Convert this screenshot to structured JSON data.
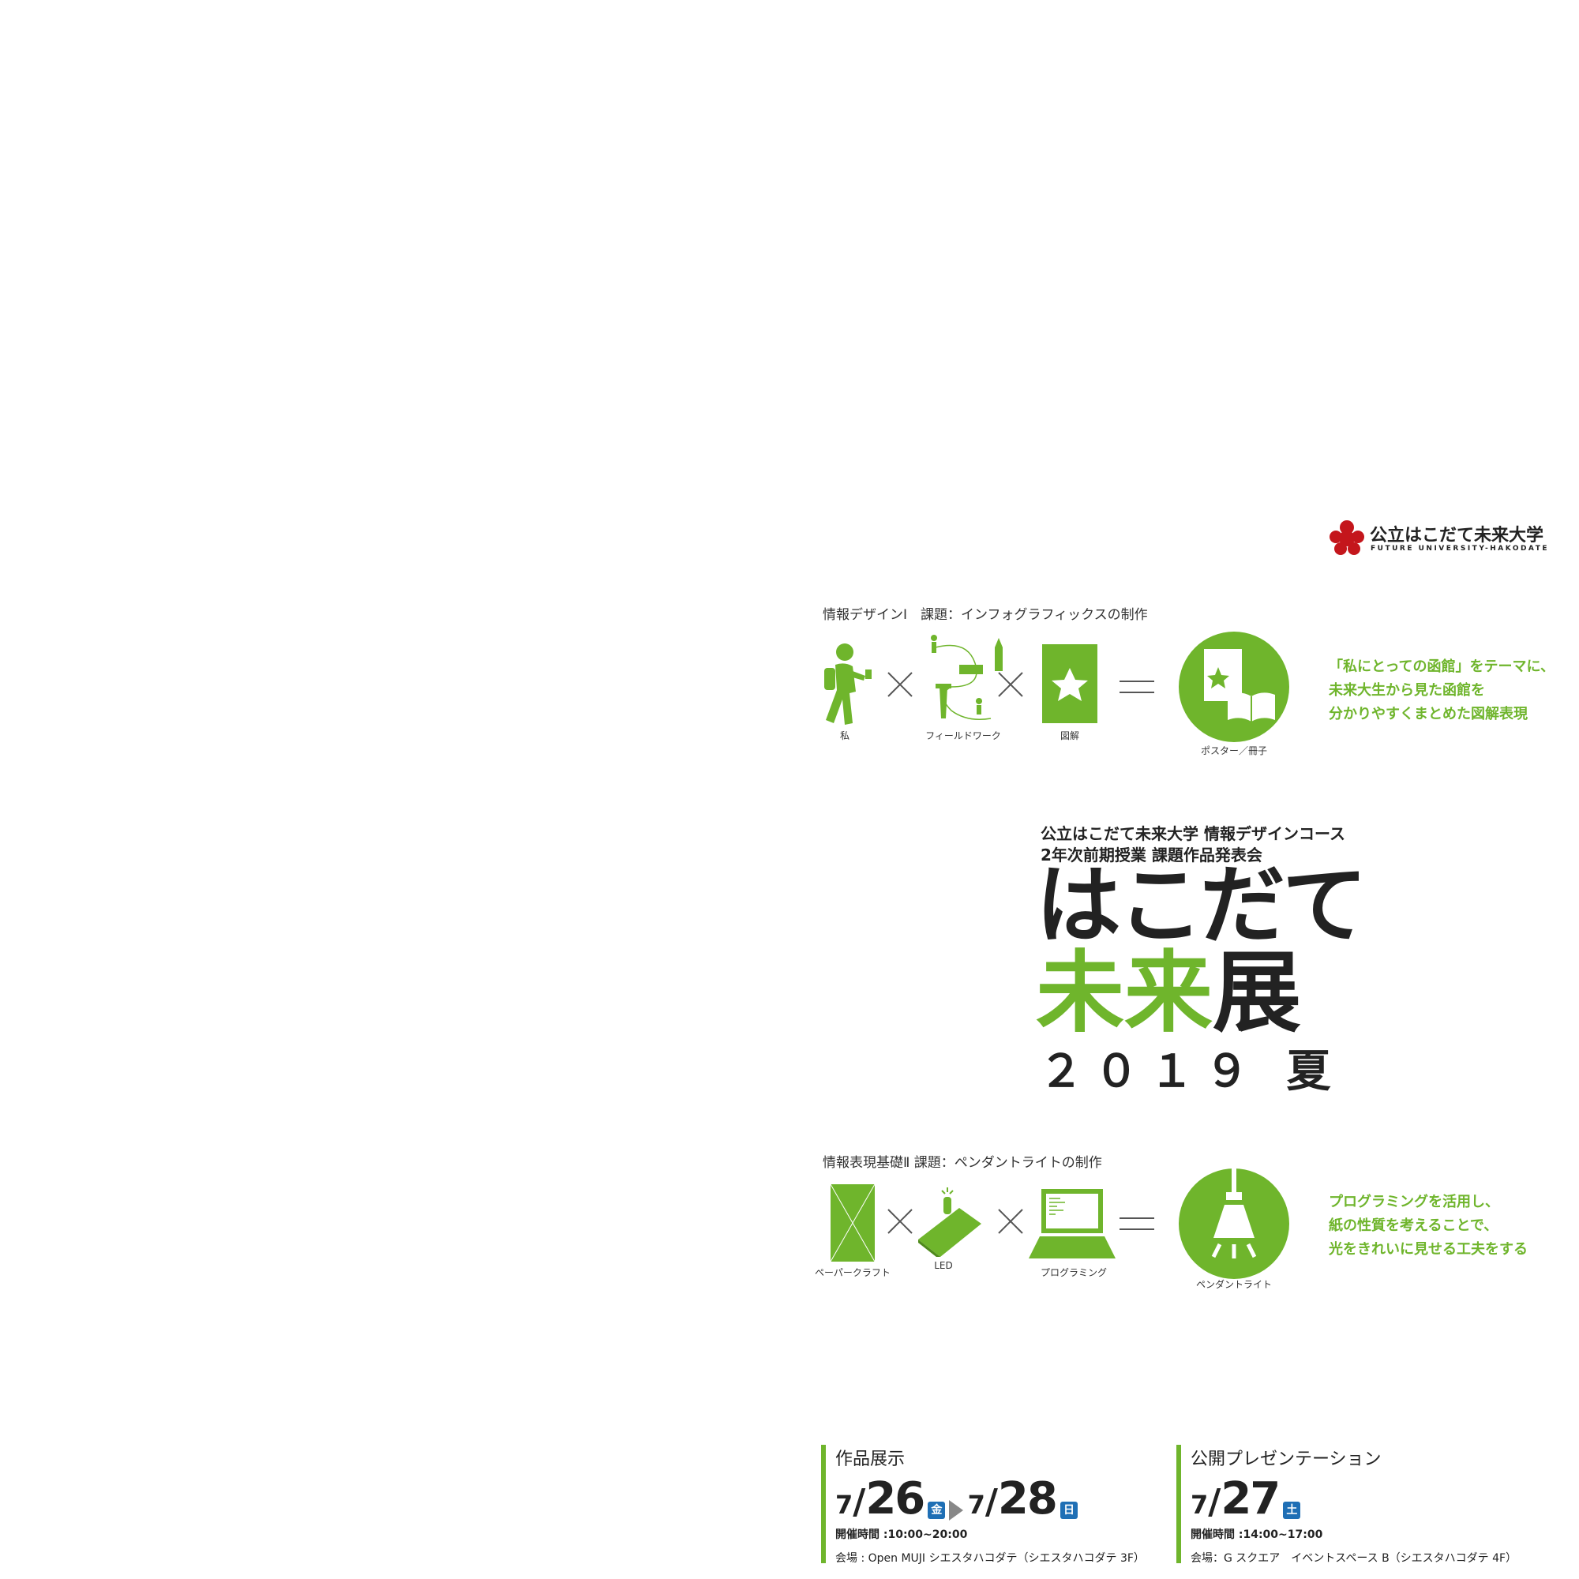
{
  "logo": {
    "name": "公立はこだて未来大学",
    "sub": "FUTURE UNIVERSITY-HAKODATE"
  },
  "section1": {
    "title": "情報デザインⅠ　課題：インフォグラフィックスの制作",
    "labels": [
      "私",
      "フィールドワーク",
      "図解",
      "ポスター／冊子"
    ],
    "desc": [
      "「私にとっての函館」をテーマに、",
      "未来大生から見た函館を",
      "分かりやすくまとめた図解表現"
    ]
  },
  "title": {
    "line1": "公立はこだて未来大学 情報デザインコース",
    "line2": "2年次前期授業 課題作品発表会",
    "main1": "はこだて",
    "main2a": "未来",
    "main2b": "展",
    "year": "２０１９ 夏"
  },
  "section2": {
    "title": "情報表現基礎Ⅱ 課題：ペンダントライトの制作",
    "labels": [
      "ペーパークラフト",
      "LED",
      "プログラミング",
      "ペンダントライト"
    ],
    "desc": [
      "プログラミングを活用し、",
      "紙の性質を考えることで、",
      "光をきれいに見せる工夫をする"
    ]
  },
  "exhibit": {
    "heading": "作品展示",
    "start_month": "7",
    "start_day": "26",
    "start_dow": "金",
    "end_month": "7",
    "end_day": "28",
    "end_dow": "日",
    "hours": "開催時間 :10:00~20:00",
    "venue": "会場 : Open MUJI シエスタハコダテ（シエスタハコダテ 3F）"
  },
  "presentation": {
    "heading": "公開プレゼンテーション",
    "month": "7",
    "day": "27",
    "dow": "土",
    "hours": "開催時間 :14:00~17:00",
    "venue": "会場：G スクエア　イベントスペース B（シエスタハコダテ 4F）"
  },
  "colors": {
    "accent": "#6fb52c",
    "logo": "#c4161c",
    "badge": "#1f6fb5"
  }
}
